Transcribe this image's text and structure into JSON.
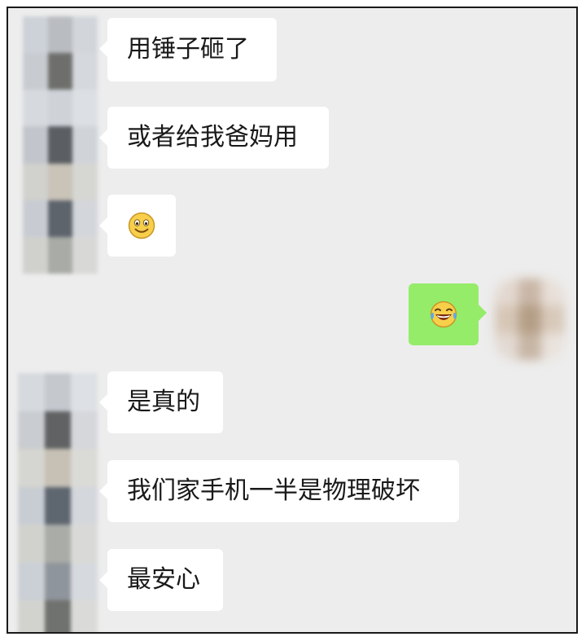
{
  "chat": {
    "messages": [
      {
        "sender": "other",
        "text": "用锤子砸了"
      },
      {
        "sender": "other",
        "text": "或者给我爸妈用"
      },
      {
        "sender": "other",
        "emoji": "smiley-face-icon"
      },
      {
        "sender": "self",
        "emoji": "tears-of-joy-icon"
      },
      {
        "sender": "other",
        "text": "是真的"
      },
      {
        "sender": "other",
        "text": "我们家手机一半是物理破坏"
      },
      {
        "sender": "other",
        "text": "最安心"
      }
    ]
  },
  "colors": {
    "background": "#ededed",
    "incoming_bubble": "#ffffff",
    "outgoing_bubble": "#95ec69",
    "text": "#191919"
  }
}
